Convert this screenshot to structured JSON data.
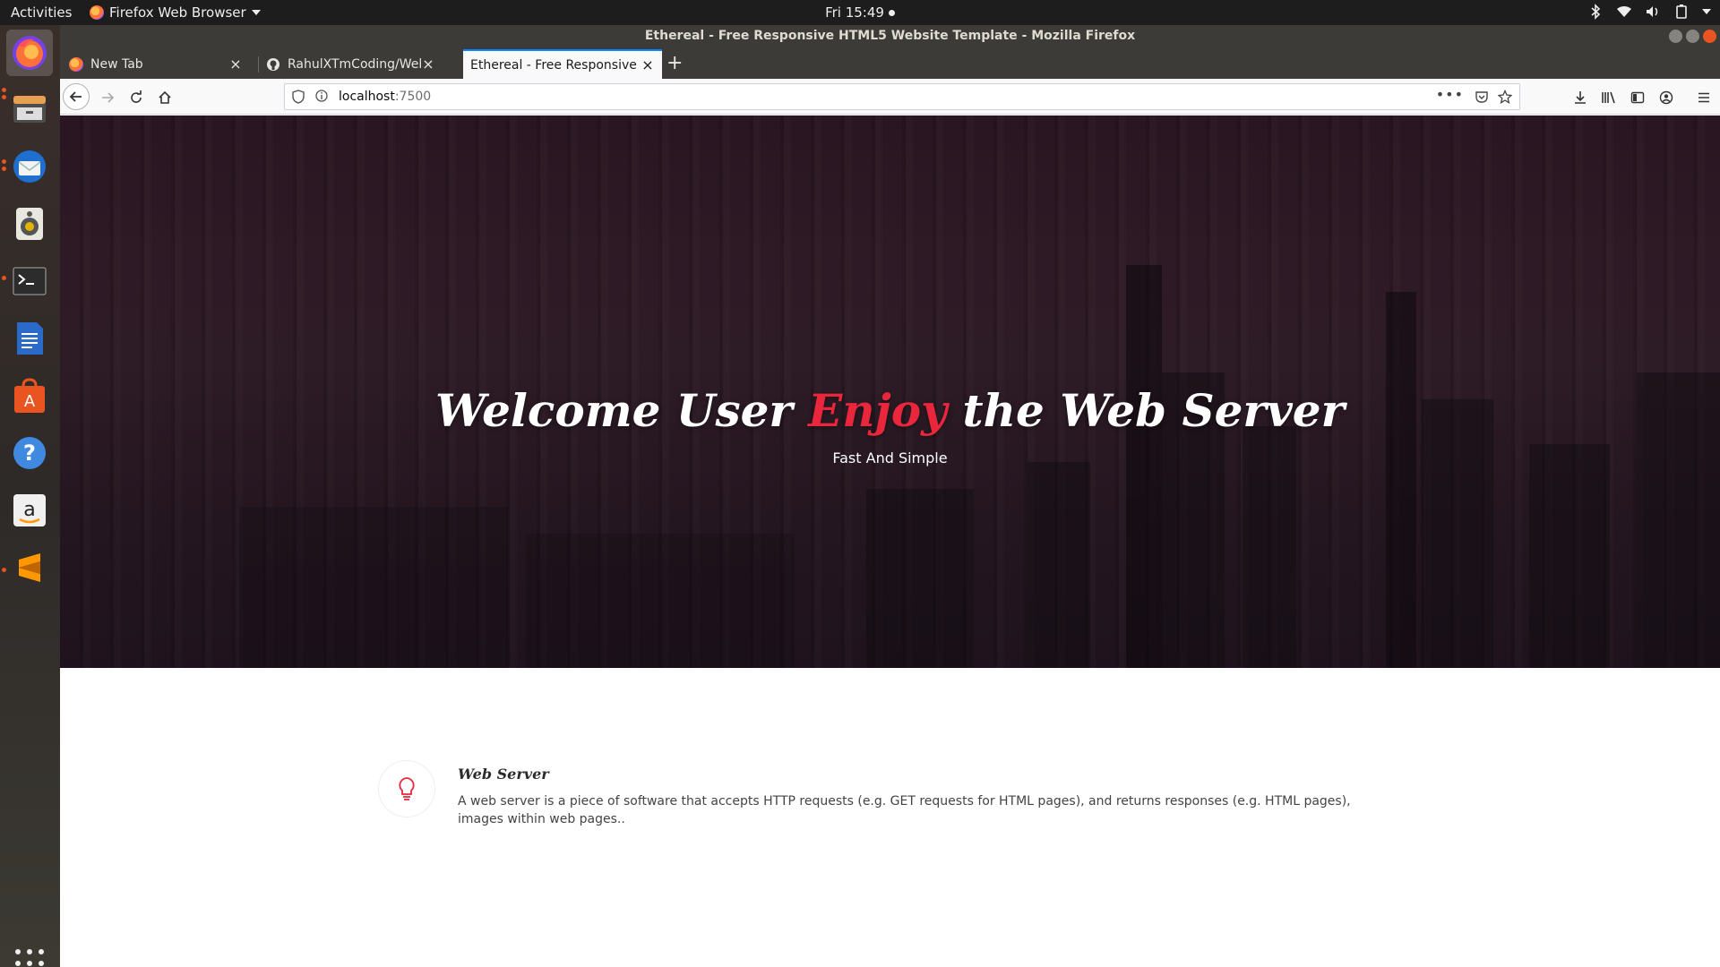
{
  "topbar": {
    "activities": "Activities",
    "app_name": "Firefox Web Browser",
    "clock": "Fri 15:49"
  },
  "dock": {
    "items": [
      "firefox-icon",
      "files-icon",
      "thunderbird-icon",
      "rhythmbox-icon",
      "terminal-icon",
      "writer-icon",
      "software-center-icon",
      "help-icon",
      "amazon-icon",
      "sublime-text-icon"
    ]
  },
  "window": {
    "title": "Ethereal - Free Responsive HTML5 Website Template - Mozilla Firefox",
    "tabs": [
      {
        "label": "New Tab"
      },
      {
        "label": "RahulXTmCoding/WebSe"
      },
      {
        "label": "Ethereal - Free Responsive H"
      }
    ],
    "url": {
      "host": "localhost",
      "port": ":7500"
    }
  },
  "page": {
    "hero": {
      "title_pre": "Welcome User ",
      "title_accent": "Enjoy",
      "title_post": " the Web Server",
      "subtitle": "Fast And Simple"
    },
    "feature": {
      "title": "Web Server",
      "text": "A web server is a piece of software that accepts HTTP requests (e.g. GET requests for HTML pages), and returns responses (e.g. HTML pages), images within web pages.."
    }
  },
  "colors": {
    "accent": "#e8263c",
    "ubuntu_orange": "#e95420",
    "tab_highlight": "#0a84ff"
  }
}
